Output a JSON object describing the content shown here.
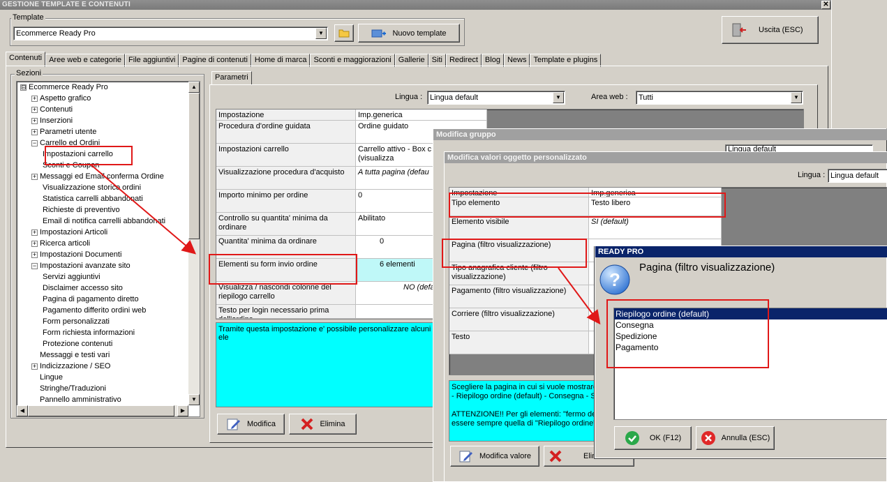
{
  "window": {
    "title": "GESTIONE TEMPLATE E CONTENUTI",
    "close": "✕"
  },
  "template": {
    "group_label": "Template",
    "selected": "Ecommerce Ready Pro",
    "new_button": "Nuovo template"
  },
  "exit_button": "Uscita (ESC)",
  "tabs": [
    "Contenuti",
    "Aree web e categorie",
    "File aggiuntivi",
    "Pagine di contenuti",
    "Home di marca",
    "Sconti e maggiorazioni",
    "Gallerie",
    "Siti",
    "Redirect",
    "Blog",
    "News",
    "Template e plugins"
  ],
  "sections": {
    "label": "Sezioni",
    "items": [
      {
        "t": "Ecommerce Ready Pro",
        "pm": "⊟"
      },
      {
        "t": "Aspetto grafico",
        "pm": "+"
      },
      {
        "t": "Contenuti",
        "pm": "+"
      },
      {
        "t": "Inserzioni",
        "pm": "+"
      },
      {
        "t": "Parametri utente",
        "pm": "+"
      },
      {
        "t": "Carrello ed Ordini",
        "pm": "−"
      },
      {
        "t": "Impostazioni carrello",
        "pm": ""
      },
      {
        "t": "Sconti e Coupon",
        "pm": ""
      },
      {
        "t": "Messaggi ed Email conferma Ordine",
        "pm": "+"
      },
      {
        "t": "Visualizzazione storico ordini",
        "pm": ""
      },
      {
        "t": "Statistica carrelli abbandonati",
        "pm": ""
      },
      {
        "t": "Richieste di preventivo",
        "pm": ""
      },
      {
        "t": "Email di notifica carrelli abbandonati",
        "pm": ""
      },
      {
        "t": "Impostazioni Articoli",
        "pm": "+"
      },
      {
        "t": "Ricerca articoli",
        "pm": "+"
      },
      {
        "t": "Impostazioni Documenti",
        "pm": "+"
      },
      {
        "t": "Impostazioni avanzate sito",
        "pm": "−"
      },
      {
        "t": "Servizi aggiuntivi",
        "pm": ""
      },
      {
        "t": "Disclaimer accesso sito",
        "pm": ""
      },
      {
        "t": "Pagina di pagamento diretto",
        "pm": ""
      },
      {
        "t": "Pagamento differito ordini web",
        "pm": ""
      },
      {
        "t": "Form personalizzati",
        "pm": ""
      },
      {
        "t": "Form richiesta informazioni",
        "pm": ""
      },
      {
        "t": "Protezione contenuti",
        "pm": ""
      },
      {
        "t": "Messaggi e testi vari",
        "pm": ""
      },
      {
        "t": "Indicizzazione / SEO",
        "pm": "+"
      },
      {
        "t": "Lingue",
        "pm": ""
      },
      {
        "t": "Stringhe/Traduzioni",
        "pm": ""
      },
      {
        "t": "Pannello amministrativo",
        "pm": ""
      }
    ]
  },
  "params": {
    "tab": "Parametri",
    "lingua_label": "Lingua :",
    "lingua": "Lingua default",
    "area_label": "Area web :",
    "area": "Tutti",
    "header": [
      "Impostazione",
      "Imp.generica"
    ],
    "rows": [
      {
        "k": "Procedura d'ordine guidata",
        "v": "Ordine guidato"
      },
      {
        "k": "Impostazioni carrello",
        "v": "Carrello attivo - Box c dettagliato (visualizza"
      },
      {
        "k": "Visualizzazione procedura d'acquisto",
        "v": "A tutta pagina (defau"
      },
      {
        "k": "Importo minimo per ordine",
        "v": "0"
      },
      {
        "k": "Controllo su quantita' minima da ordinare",
        "v": "Abilitato"
      },
      {
        "k": "Quantita' minima da ordinare",
        "v": "0"
      },
      {
        "k": "Elementi su form invio ordine",
        "v": "6 elementi"
      },
      {
        "k": "Visualizza / nascondi colonne del riepilogo carrello",
        "v": "NO (default)"
      },
      {
        "k": "Testo per login necessario prima dell'ordine",
        "v": ""
      }
    ],
    "desc": "Tramite questa impostazione e' possibile personalizzare alcuni ele",
    "modify": "Modifica",
    "delete": "Elimina"
  },
  "dlg_group": {
    "title": "Modifica gruppo",
    "lingua": "Lingua default"
  },
  "dlg_obj": {
    "title": "Modifica valori oggetto personalizzato",
    "lingua_label": "Lingua :",
    "lingua": "Lingua default",
    "header": [
      "Impostazione",
      "Imp.generica"
    ],
    "rows": [
      {
        "k": "Tipo elemento",
        "v": "Testo libero"
      },
      {
        "k": "Elemento visibile",
        "v": "SI (default)"
      },
      {
        "k": "Pagina (filtro visualizzazione)",
        "v": ""
      },
      {
        "k": "Tipo anagrafica cliente (filtro visualizzazione)",
        "v": ""
      },
      {
        "k": "Pagamento (filtro visualizzazione)",
        "v": ""
      },
      {
        "k": "Corriere (filtro visualizzazione)",
        "v": ""
      },
      {
        "k": "Testo",
        "v": ""
      }
    ],
    "desc1": "Scegliere la pagina in cui si vuole mostrare",
    "desc2": "- Riepilogo ordine (default) - Consegna - Sp",
    "desc3": "ATTENZIONE!! Per gli elementi: \"fermo dep",
    "desc4": "essere sempre quella di \"Riepilogo ordine\";",
    "modify": "Modifica valore",
    "delete": "Elimi"
  },
  "dlg_ready": {
    "title": "READY PRO",
    "question": "Pagina (filtro visualizzazione)",
    "options": [
      "Riepilogo ordine (default)",
      "Consegna",
      "Spedizione",
      "Pagamento"
    ],
    "ok": "OK (F12)",
    "cancel": "Annulla (ESC)"
  }
}
